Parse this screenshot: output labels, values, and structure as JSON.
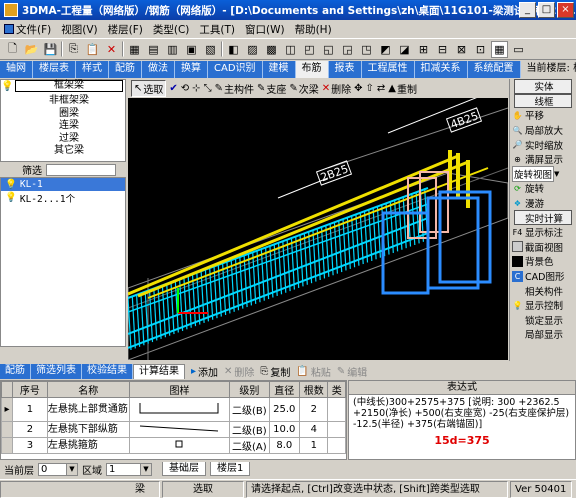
{
  "title": "3DMA-工程量（网络版）/钢筋（网络版）- [D:\\Documents and Settings\\zh\\桌面\\11G101-梁测试工程\\22...",
  "window_buttons": {
    "minimize": "_",
    "maximize": "□",
    "close": "×"
  },
  "menu": [
    "文件(F)",
    "视图(V)",
    "楼层(F)",
    "类型(C)",
    "工具(T)",
    "窗口(W)",
    "帮助(H)"
  ],
  "tabs": [
    "轴网",
    "楼层表",
    "样式",
    "配筋",
    "做法",
    "换算",
    "CAD识别",
    "建模",
    "布筋",
    "报表",
    "工程属性",
    "扣减关系",
    "系统配置"
  ],
  "active_tab_index": 8,
  "current_floor_label": "当前楼层: 楼",
  "tree": [
    "框架梁",
    "非框架梁",
    "圈梁",
    "连梁",
    "过梁",
    "其它梁"
  ],
  "filter_label": "筛选",
  "components": [
    "KL-1",
    "KL-2...1个"
  ],
  "viewport_toolbar": [
    "选取",
    "主构件",
    "支座",
    "次梁",
    "删除",
    "重制"
  ],
  "viewport_labels": {
    "top_right": "4B25",
    "left": "2B25"
  },
  "right_panel": [
    "实体",
    "线框",
    "平移",
    "局部放大",
    "实时缩放",
    "满屏显示",
    "旋转视图",
    "旋转",
    "漫游",
    "实时计算",
    "显示标注",
    "截面视图",
    "背景色",
    "CAD图形",
    "相关构件",
    "显示控制",
    "锁定显示",
    "局部显示"
  ],
  "bottom_tabs": [
    "配筋",
    "筛选列表",
    "校验结果",
    "计算结果"
  ],
  "bottom_tools": {
    "add": "添加",
    "delete": "删除",
    "copy": "复制",
    "paste": "粘贴",
    "edit": "编辑"
  },
  "grid": {
    "headers": [
      "序号",
      "名称",
      "图样",
      "级别",
      "直径",
      "根数",
      "类"
    ],
    "rows": [
      {
        "no": "1",
        "name": "左悬挑上部贯通筋",
        "level": "二级(B)",
        "dia": "25.0",
        "count": "2"
      },
      {
        "no": "2",
        "name": "左悬挑下部纵筋",
        "level": "二级(B)",
        "dia": "10.0",
        "count": "4"
      },
      {
        "no": "3",
        "name": "左悬挑箍筋",
        "level": "二级(A)",
        "dia": "8.0",
        "count": "1"
      }
    ]
  },
  "expression": {
    "header": "表达式",
    "text": "(中线长)300+2575+375 [说明: 300 +2362.5 +2150(净长) +500(右支座宽) -25(右支座保护层) -12.5(半径) +375(右端锚固)]",
    "annotation": "15d=375"
  },
  "floorbar": {
    "label": "当前层",
    "floor": "0",
    "area_label": "区域",
    "area": "1",
    "tabs": [
      "基础层",
      "楼层1"
    ]
  },
  "status": {
    "type": "梁",
    "mode": "选取",
    "hint": "请选择起点, [Ctrl]改变选中状态, [Shift]跨类型选取",
    "version": "Ver 50401"
  },
  "colors": {
    "titlebar": "#0b3ea8",
    "tab": "#2a6fd0",
    "rebar_cyan": "#00d8ff",
    "rebar_yellow": "#f0e000",
    "rebar_pink": "#f4b8a8",
    "annotation": "#e00000"
  }
}
